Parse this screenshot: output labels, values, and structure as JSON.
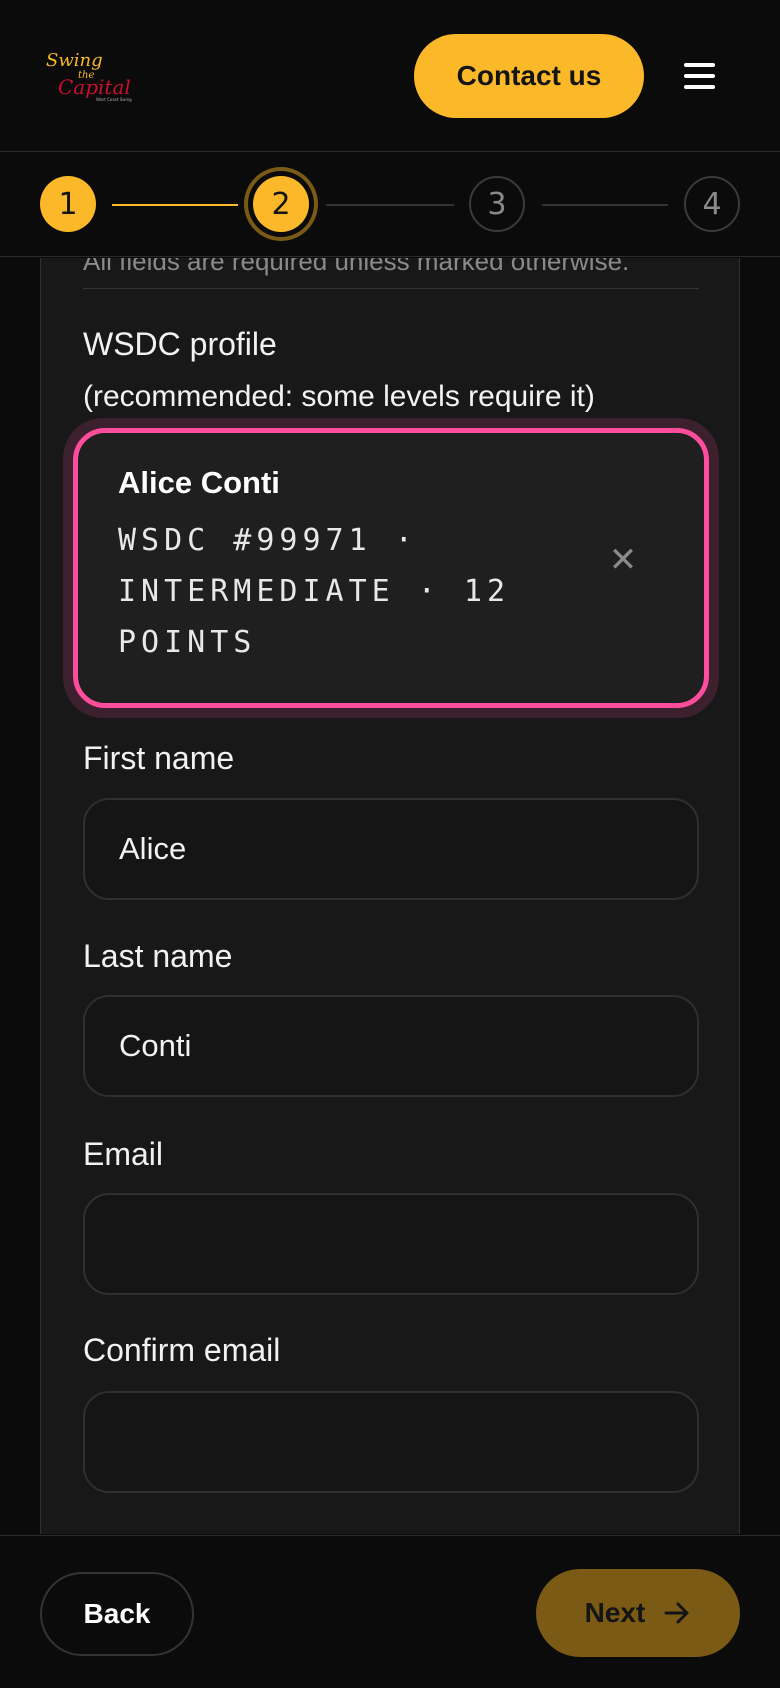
{
  "header": {
    "logo_text": "Swing the Capital",
    "contact_label": "Contact us",
    "menu_icon": "hamburger-menu-icon"
  },
  "stepper": {
    "steps": [
      "1",
      "2",
      "3",
      "4"
    ],
    "current_step": 2,
    "accent_color": "#fbb929"
  },
  "form": {
    "hint": "All fields are required unless marked otherwise.",
    "wsdc": {
      "label": "WSDC profile",
      "sub_label": "(recommended: some levels require it)",
      "selected_name": "Alice Conti",
      "selected_meta": "WSDC #99971 · INTERMEDIATE · 12 POINTS",
      "clear_icon": "close-icon",
      "highlight_color": "#ff4d9d"
    },
    "first_name": {
      "label": "First name",
      "value": "Alice"
    },
    "last_name": {
      "label": "Last name",
      "value": "Conti"
    },
    "email": {
      "label": "Email",
      "value": ""
    },
    "confirm_email": {
      "label": "Confirm email",
      "value": ""
    }
  },
  "footer": {
    "back_label": "Back",
    "next_label": "Next",
    "next_icon": "arrow-right-icon"
  }
}
